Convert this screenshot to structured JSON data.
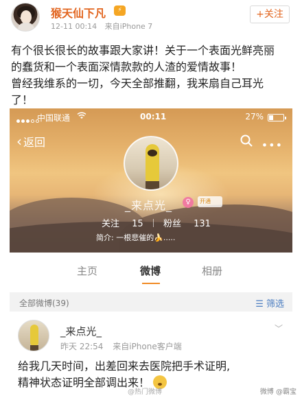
{
  "post": {
    "username": "猴天仙下凡",
    "vip_badge": "⚡",
    "time": "12-11 00:14",
    "source": "来自iPhone 7",
    "follow_label": "+关注",
    "text_line1": "有个很长很长的故事跟大家讲！关于一个表面光鲜亮丽",
    "text_line2": "的蠢货和一个表面深情款款的人渣的爱情故事！",
    "text_line3": "曾经我维系的一切，今天全部推翻，我来扇自己耳光",
    "text_line4": "了！"
  },
  "embed": {
    "status_bar": {
      "carrier": "中国联通",
      "time": "00:11",
      "battery": "27%"
    },
    "nav": {
      "back_label": "返回"
    },
    "profile": {
      "name": "_来点光_",
      "gender_icon": "♀",
      "vip_text": "开通",
      "following_label": "关注",
      "following_count": "15",
      "fans_label": "粉丝",
      "fans_count": "131",
      "bio": "简介: 一根悲催的🍌....."
    },
    "tabs": [
      {
        "label": "主页"
      },
      {
        "label": "微博"
      },
      {
        "label": "相册"
      }
    ],
    "filter": {
      "all_label": "全部微博(39)",
      "filter_label": "筛选"
    },
    "item": {
      "name": "_来点光_",
      "time": "昨天 22:54",
      "source": "来自iPhone客户端",
      "text_line1": "给我几天时间，出差回来去医院把手术证明,",
      "text_line2": "精神状态证明全部调出来！"
    },
    "watermark": "微博 @霸宝",
    "watermark2": "@热门微博"
  },
  "colors": {
    "accent_orange": "#e2651f",
    "tab_indicator": "#f08a24",
    "link_blue": "#4a7cc0"
  }
}
